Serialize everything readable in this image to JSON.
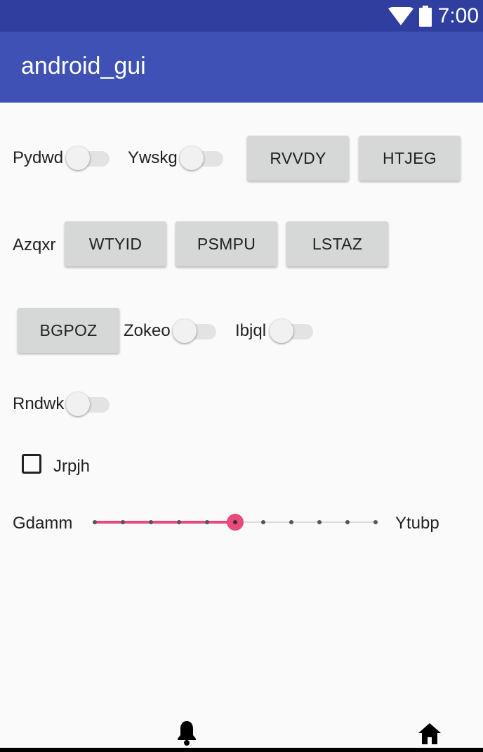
{
  "status_bar": {
    "time": "7:00",
    "wifi_icon": "wifi-icon",
    "battery_icon": "battery-icon"
  },
  "app_bar": {
    "title": "android_gui"
  },
  "row1": {
    "switch1_label": "Pydwd",
    "switch2_label": "Ywskg",
    "button1": "RVVDY",
    "button2": "HTJEG"
  },
  "row2": {
    "label": "Azqxr",
    "button1": "WTYID",
    "button2": "PSMPU",
    "button3": "LSTAZ"
  },
  "row3": {
    "button1": "BGPOZ",
    "switch1_label": "Zokeo",
    "switch2_label": "Ibjql"
  },
  "row4": {
    "switch_label": "Rndwk"
  },
  "checkbox": {
    "label": "Jrpjh",
    "checked": false
  },
  "seekbar": {
    "left_label": "Gdamm",
    "right_label": "Ytubp",
    "max": 10,
    "value": 5,
    "accent_color": "#e84a7b"
  },
  "bottom_nav": {
    "left_icon": "bell-icon",
    "right_icon": "home-icon"
  },
  "colors": {
    "status_bar": "#303f9f",
    "app_bar": "#3f51b5",
    "background": "#fafafa"
  }
}
